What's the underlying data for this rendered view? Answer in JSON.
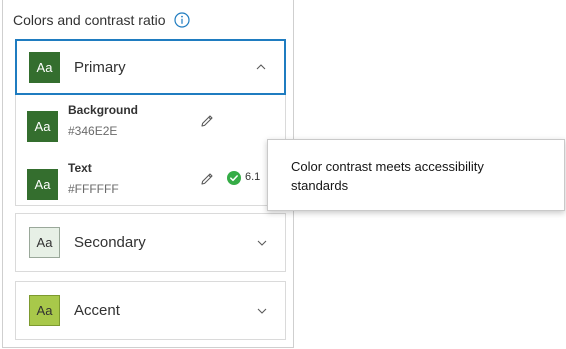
{
  "panel": {
    "title": "Colors and contrast ratio",
    "info_icon": "info-circle-icon"
  },
  "sections": {
    "primary": {
      "label": "Primary",
      "swatch_text": "Aa",
      "swatch_bg": "#346E2E",
      "swatch_fg": "#FFFFFF",
      "expanded": true,
      "colors": [
        {
          "name": "Background",
          "hex": "#346E2E",
          "swatch_text": "Aa",
          "swatch_bg": "#346E2E",
          "swatch_fg": "#FFFFFF"
        },
        {
          "name": "Text",
          "hex": "#FFFFFF",
          "swatch_text": "Aa",
          "swatch_bg": "#346E2E",
          "swatch_fg": "#FFFFFF",
          "contrast": "6.1"
        }
      ]
    },
    "secondary": {
      "label": "Secondary",
      "swatch_text": "Aa",
      "swatch_bg": "#E7F0E6",
      "swatch_fg": "#323232",
      "expanded": false
    },
    "accent": {
      "label": "Accent",
      "swatch_text": "Aa",
      "swatch_bg": "#A8C84A",
      "swatch_fg": "#323232",
      "expanded": false
    }
  },
  "tooltip": {
    "text": "Color contrast meets accessibility standards"
  },
  "colors": {
    "focus_border": "#1F7CC0",
    "success": "#35AC46",
    "info_icon": "#1F7CC0"
  }
}
